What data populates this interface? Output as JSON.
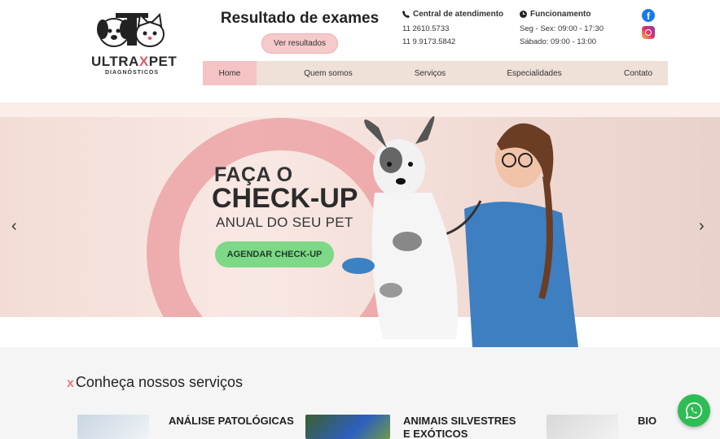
{
  "logo": {
    "brand_part1": "ULTRA",
    "brand_x": "X",
    "brand_part2": "PET",
    "subtitle": "DIAGNÓSTICOS"
  },
  "results": {
    "title": "Resultado de exames",
    "button": "Ver resultados"
  },
  "contact": {
    "title": "Central de atendimento",
    "phone1": "11 2610.5733",
    "phone2": "11 9.9173.5842",
    "icon": "phone-icon"
  },
  "hours": {
    "title": "Funcionamento",
    "weekdays": "Seg - Sex: 09:00 - 17:30",
    "saturday": "Sábado: 09:00 - 13:00",
    "icon": "clock-icon"
  },
  "social": {
    "facebook_glyph": "f",
    "icons": [
      "facebook-icon",
      "instagram-icon"
    ]
  },
  "nav": {
    "items": [
      {
        "label": "Home"
      },
      {
        "label": "Quem somos"
      },
      {
        "label": "Serviços"
      },
      {
        "label": "Especialidades"
      },
      {
        "label": "Contato"
      }
    ]
  },
  "hero": {
    "line1": "FAÇA O",
    "line2": "CHECK-UP",
    "line3": "ANUAL DO SEU PET",
    "button": "AGENDAR CHECK-UP",
    "prev_glyph": "‹",
    "next_glyph": "›"
  },
  "services": {
    "heading_mark": "x",
    "heading": "Conheça nossos serviços",
    "cards": [
      {
        "name": "ANÁLISE PATOLÓGICAS"
      },
      {
        "name": "ANIMAIS SILVESTRES E EXÓTICOS"
      },
      {
        "name": "BIO"
      }
    ]
  },
  "colors": {
    "accent_pink": "#f5c3c4",
    "nav_bg": "#efe0d8",
    "cta_green": "#7dd888",
    "whatsapp_green": "#2ebd55"
  }
}
